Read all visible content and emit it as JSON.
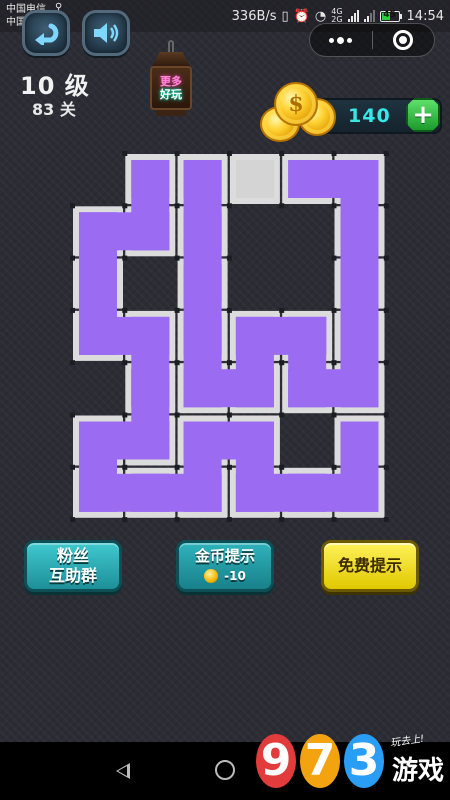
{
  "status_bar": {
    "carrier_1": "中国电信",
    "carrier_2": "中国移动",
    "usb_icon": "usb-icon",
    "net_speed": "336B/s",
    "network_1": "4G",
    "network_2": "2G",
    "battery_level": "45",
    "time": "14:54"
  },
  "toolbar": {
    "back_icon": "undo-arrow-icon",
    "sound_icon": "speaker-icon",
    "more_icon": "more-dots-icon",
    "close_icon": "target-close-icon"
  },
  "level": {
    "title": "10 级",
    "subtitle": "83 关"
  },
  "more_games": {
    "line1": "更多",
    "line2": "好玩"
  },
  "wallet": {
    "coin_symbol": "$",
    "coins": "140",
    "add_label": "+"
  },
  "board": {
    "grid": {
      "cols": 6,
      "rows": 7
    },
    "colors": {
      "path": "#9b6bf2",
      "cell": "#dcdcdc",
      "empty": "#d4d4d4",
      "wall": "#1c1d22",
      "separator": "#f2f2f2"
    },
    "empty_cells": [
      [
        3,
        0
      ]
    ],
    "path": [
      [
        2,
        0
      ],
      [
        2,
        1
      ],
      [
        2,
        2
      ],
      [
        2,
        3
      ],
      [
        2,
        4
      ],
      [
        3,
        4
      ],
      [
        3,
        3
      ],
      [
        4,
        3
      ],
      [
        4,
        4
      ],
      [
        5,
        4
      ],
      [
        5,
        3
      ],
      [
        5,
        2
      ],
      [
        5,
        1
      ],
      [
        5,
        0
      ],
      [
        4,
        0
      ],
      [
        1,
        0
      ],
      [
        1,
        1
      ],
      [
        0,
        1
      ],
      [
        0,
        2
      ],
      [
        0,
        3
      ],
      [
        1,
        3
      ],
      [
        1,
        4
      ],
      [
        1,
        5
      ],
      [
        0,
        5
      ],
      [
        0,
        6
      ],
      [
        1,
        6
      ],
      [
        2,
        6
      ],
      [
        2,
        5
      ],
      [
        3,
        5
      ],
      [
        3,
        6
      ],
      [
        4,
        6
      ],
      [
        5,
        6
      ],
      [
        5,
        5
      ]
    ],
    "path_segments": [
      [
        [
          2,
          0
        ],
        [
          2,
          1
        ],
        [
          2,
          2
        ],
        [
          2,
          3
        ],
        [
          2,
          4
        ],
        [
          3,
          4
        ],
        [
          3,
          3
        ],
        [
          4,
          3
        ],
        [
          4,
          4
        ],
        [
          5,
          4
        ],
        [
          5,
          3
        ],
        [
          5,
          2
        ],
        [
          5,
          1
        ],
        [
          5,
          0
        ],
        [
          4,
          0
        ]
      ],
      [
        [
          1,
          0
        ],
        [
          1,
          1
        ],
        [
          0,
          1
        ],
        [
          0,
          2
        ],
        [
          0,
          3
        ],
        [
          1,
          3
        ],
        [
          1,
          4
        ],
        [
          1,
          5
        ],
        [
          0,
          5
        ],
        [
          0,
          6
        ],
        [
          1,
          6
        ],
        [
          2,
          6
        ],
        [
          2,
          5
        ],
        [
          3,
          5
        ],
        [
          3,
          6
        ],
        [
          4,
          6
        ],
        [
          5,
          6
        ],
        [
          5,
          5
        ]
      ]
    ],
    "walls": [
      {
        "cell": [
          0,
          4
        ],
        "open_vertical": true
      }
    ]
  },
  "buttons": {
    "fans_line1": "粉丝",
    "fans_line2": "互助群",
    "coin_hint": "金币提示",
    "coin_hint_cost": "-10",
    "free_hint": "免费提示"
  },
  "navbar": {
    "back_icon": "nav-back-icon",
    "home_icon": "nav-home-icon"
  },
  "watermark": {
    "digits": [
      "9",
      "7",
      "3"
    ],
    "brand": "游戏",
    "slogan": "玩去上!"
  }
}
